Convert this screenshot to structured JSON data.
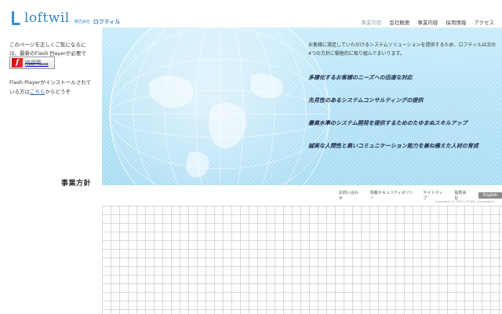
{
  "header": {
    "logo_word": "loftwil",
    "logo_sub": "株式会社",
    "logo_kana": "ロフティル",
    "brand_color": "#2f86cc",
    "nav": [
      {
        "label": "事業内容",
        "current": true
      },
      {
        "label": "会社概要"
      },
      {
        "label": "事業内容"
      },
      {
        "label": "採用情報"
      },
      {
        "label": "アクセス"
      }
    ]
  },
  "flash": {
    "note": "このページを正しくご覧になるには、最新のFlash Playerが必要です。",
    "badge_top": "Get ADOBE",
    "badge_bottom": "FLASH PLAYER",
    "badge_icon": "flash-icon",
    "install_prefix": "Flash Playerがインストールされている方は",
    "install_link": "こちら",
    "install_suffix": "からどうぞ"
  },
  "policy_title": "事業方針",
  "hero": {
    "intro": "お客様に満足していただけるシステムソリューションを提供するため、ロフティルは次の4つの方針に積極的に取り組んでまいります。",
    "points": [
      "多様化するお客様のニーズへの迅速な対応",
      "先見性のあるシステムコンサルティングの提供",
      "最高水準のシステム開発を提供するためのたゆまぬスキルアップ",
      "誠実な人間性と高いコミュニケーション能力を兼ね備えた人材の育成"
    ]
  },
  "footer": {
    "links": [
      "お問い合わせ",
      "情報セキュリティポリシー",
      "サイトマップ",
      "提携会社"
    ],
    "english": "English",
    "copyright": "Copyright (C) 2007 LOFWIL Corporation"
  }
}
